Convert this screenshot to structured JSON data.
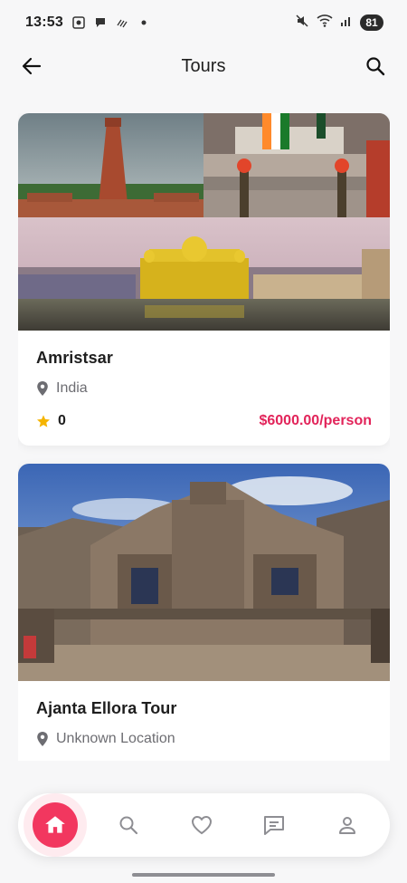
{
  "status_bar": {
    "time": "13:53",
    "battery": "81"
  },
  "app_bar": {
    "title": "Tours"
  },
  "tours": [
    {
      "title": "Amristsar",
      "location": "India",
      "rating": "0",
      "price": "$6000.00/person"
    },
    {
      "title": "Ajanta Ellora Tour",
      "location": "Unknown Location",
      "rating": "",
      "price": ""
    }
  ],
  "colors": {
    "accent": "#f2375f",
    "price": "#e2245a",
    "star": "#f5b400"
  },
  "bottom_nav": {
    "items": [
      {
        "icon": "home-icon",
        "active": true
      },
      {
        "icon": "search-icon",
        "active": false
      },
      {
        "icon": "heart-icon",
        "active": false
      },
      {
        "icon": "chat-icon",
        "active": false
      },
      {
        "icon": "person-icon",
        "active": false
      }
    ]
  }
}
